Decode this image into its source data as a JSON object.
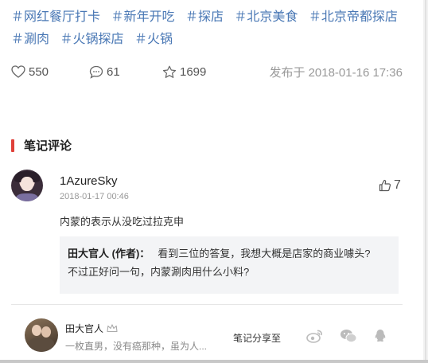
{
  "tags": [
    "＃网红餐厅打卡",
    "＃新年开吃",
    "＃探店",
    "＃北京美食",
    "＃北京帝都探店",
    "＃涮肉",
    "＃火锅探店",
    "＃火锅"
  ],
  "stats": {
    "likes": "550",
    "comments": "61",
    "favorites": "1699"
  },
  "publish": {
    "label": "发布于",
    "datetime": "2018-01-16 17:36"
  },
  "section_title": "笔记评论",
  "comment": {
    "user": "1AzureSky",
    "time": "2018-01-17 00:46",
    "likes": "7",
    "text": "内蒙的表示从没吃过拉克申",
    "reply": {
      "author": "田大官人 (作者)：",
      "line1": "看到三位的答复，我想大概是店家的商业噱头?",
      "line2": "不过正好问一句，内蒙涮肉用什么小料?"
    }
  },
  "footer": {
    "author": "田大官人",
    "bio": "一枚直男，没有癌那种，虽为人...",
    "share_label": "笔记分享至"
  },
  "colors": {
    "tag": "#4a78b5",
    "accent": "#e0413a",
    "icon": "#bbbbbb"
  }
}
